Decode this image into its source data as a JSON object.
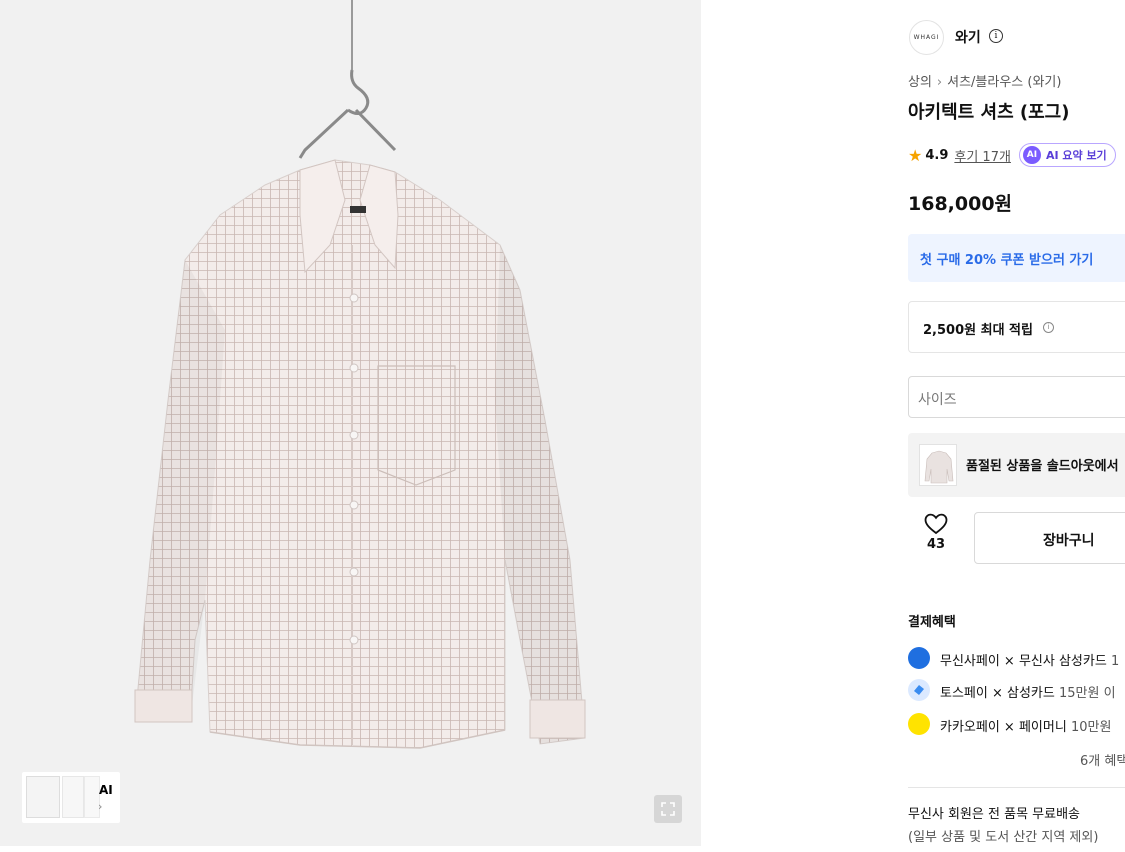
{
  "gallery": {
    "shirt_label": "WHAGI",
    "thumb_ai_label": "AI",
    "thumb_chevron": "›"
  },
  "brand": {
    "logo_text": "WHAGI",
    "name": "와기",
    "info_icon": "i"
  },
  "breadcrumb": {
    "items": [
      "상의",
      "셔츠/블라우스 (와기)"
    ],
    "separator": "›"
  },
  "product": {
    "title": "아키텍트 셔츠 (포그)",
    "rating": "4.9",
    "reviews": "후기 17개",
    "ai_badge": "AI",
    "ai_summary": "AI 요약 보기",
    "price": "168,000원"
  },
  "coupon": {
    "label": "첫 구매 20% 쿠폰 받으러 가기"
  },
  "points": {
    "label": "2,500원 최대 적립",
    "info_icon": "i"
  },
  "size": {
    "placeholder": "사이즈"
  },
  "soldout": {
    "label": "품절된 상품을 솔드아웃에서"
  },
  "actions": {
    "like_count": "43",
    "cart_label": "장바구니"
  },
  "benefits": {
    "title": "결제혜택",
    "items": [
      {
        "name": "무신사페이 × 무신사 삼성카드",
        "extra": " 1",
        "icon": "samsung-card-icon",
        "color": "#1f6fe0"
      },
      {
        "name": "토스페이 × 삼성카드",
        "extra": " 15만원 이",
        "icon": "toss-icon",
        "color": "#3a8cf0"
      },
      {
        "name": "카카오페이 × 페이머니",
        "extra": " 10만원",
        "icon": "kakaopay-icon",
        "color": "#ffe300"
      }
    ],
    "more": "6개 혜택"
  },
  "shipping": {
    "line1": "무신사 회원은 전 품목 무료배송",
    "line2": "(일부 상품 및 도서 산간 지역 제외)"
  },
  "colors": {
    "coupon_text": "#2a6be8",
    "ai_purple": "#7b5cff",
    "star": "#f6a300"
  }
}
